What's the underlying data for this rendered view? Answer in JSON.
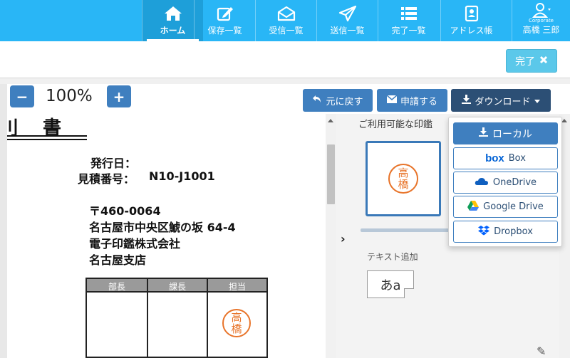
{
  "nav": {
    "items": [
      {
        "label": "ホーム",
        "icon": "home-icon",
        "active": true
      },
      {
        "label": "保存一覧",
        "icon": "edit-icon"
      },
      {
        "label": "受信一覧",
        "icon": "inbox-icon"
      },
      {
        "label": "送信一覧",
        "icon": "send-icon"
      },
      {
        "label": "完了一覧",
        "icon": "list-icon"
      },
      {
        "label": "アドレス帳",
        "icon": "address-book-icon"
      }
    ],
    "user": {
      "tag": "Corporate",
      "name": "高橋 三郎",
      "icon": "user-icon"
    }
  },
  "subbar": {
    "done_label": "完了",
    "done_icon": "close-icon"
  },
  "viewer": {
    "zoom_minus": "−",
    "zoom_plus": "+",
    "zoom_level": "100%",
    "undo_label": "元に戻す",
    "apply_label": "申請する",
    "download_label": "ダウンロード"
  },
  "document": {
    "title_fragment": "書",
    "issue_label": "発行日：",
    "estimate_label": "見積番号：",
    "estimate_number": "N10-J1001",
    "postal": "〒460-0064",
    "address": "名古屋市中央区鯱の坂 64-4",
    "company": "電子印鑑株式会社",
    "branch": "名古屋支店",
    "table_headers": [
      "部長",
      "課長",
      "担当"
    ],
    "seal_text": [
      "高",
      "橋"
    ]
  },
  "panel": {
    "stamps_label": "ご利用可能な印鑑",
    "stamp_seal": [
      "高",
      "橋"
    ],
    "text_add_label": "テキスト追加",
    "text_add_sample": "あa"
  },
  "download_menu": {
    "items": [
      {
        "label": "ローカル",
        "icon": "download-icon"
      },
      {
        "label": "Box",
        "icon": "box-logo-icon"
      },
      {
        "label": "OneDrive",
        "icon": "onedrive-icon"
      },
      {
        "label": "Google Drive",
        "icon": "google-drive-icon"
      },
      {
        "label": "Dropbox",
        "icon": "dropbox-icon"
      }
    ]
  },
  "colors": {
    "brand": "#29b6f6",
    "primary": "#3f7fbf",
    "dark": "#2c4f75",
    "seal": "#e8742a"
  }
}
